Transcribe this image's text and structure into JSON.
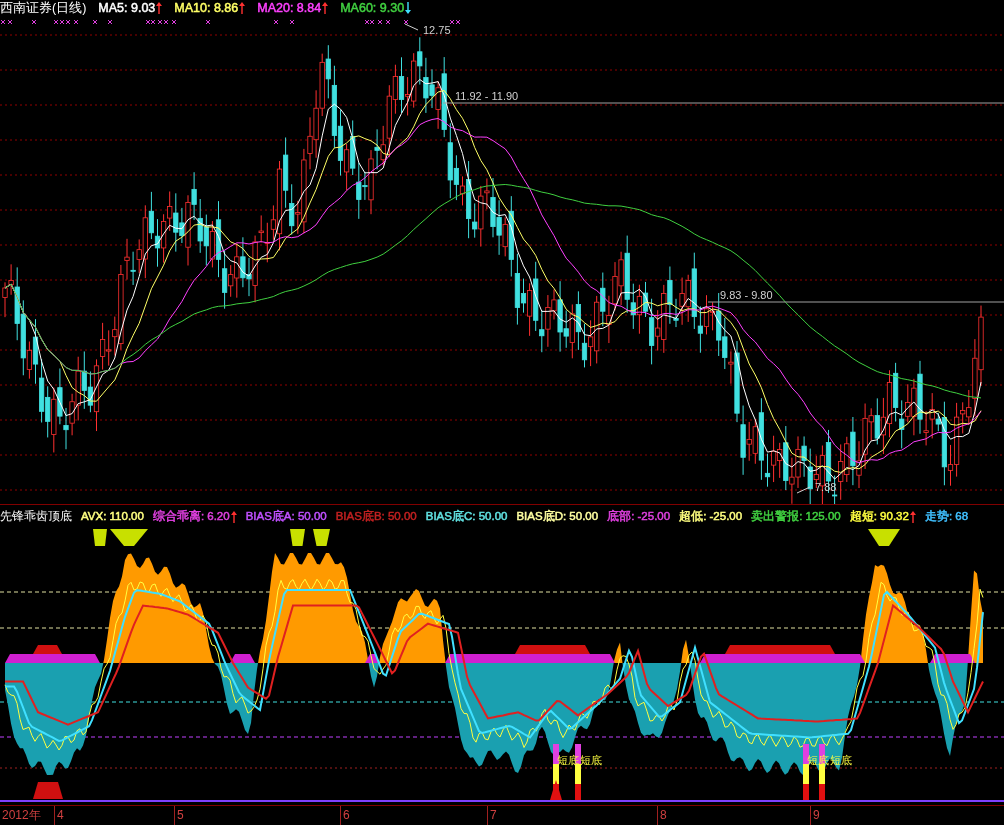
{
  "price_panel": {
    "title": "西南证券(日线)",
    "indicators": [
      {
        "text": "MA5: 9.03",
        "color": "#ffffff",
        "rising": true
      },
      {
        "text": "MA10: 8.86",
        "color": "#ffff66",
        "rising": true
      },
      {
        "text": "MA20: 8.84",
        "color": "#ff40ff",
        "rising": true
      },
      {
        "text": "MA60: 9.30",
        "color": "#40d040",
        "rising": false
      }
    ],
    "price_annotations": [
      {
        "kind": "peak",
        "text": "12.75"
      },
      {
        "kind": "level",
        "text": "11.92 - 11.90"
      },
      {
        "kind": "level",
        "text": "9.83 - 9.80"
      },
      {
        "kind": "trough",
        "text": "7.88"
      }
    ]
  },
  "indicator_panel": {
    "title": "先锋乖齿顶底",
    "indicators": [
      {
        "text": "AVX: 110.00",
        "color": "#ffff80"
      },
      {
        "text": "综合乖离: 6.20",
        "color": "#e040e0",
        "rising": true
      },
      {
        "text": "BIAS底A: 50.00",
        "color": "#c050ff"
      },
      {
        "text": "BIAS底B: 50.00",
        "color": "#c02020"
      },
      {
        "text": "BIAS底C: 50.00",
        "color": "#60e0e0"
      },
      {
        "text": "BIAS底D: 50.00",
        "color": "#ffffa0"
      },
      {
        "text": "底部: -25.00",
        "color": "#e040e0"
      },
      {
        "text": "超低: -25.00",
        "color": "#ffff80"
      },
      {
        "text": "卖出警报: 125.00",
        "color": "#40d040"
      },
      {
        "text": "超短: 90.32",
        "color": "#ffff40",
        "rising": true
      },
      {
        "text": "走势: 68",
        "color": "#40c0ff"
      }
    ],
    "signals": [
      {
        "text": "短底"
      },
      {
        "text": "短底"
      },
      {
        "text": "短底"
      },
      {
        "text": "短底"
      }
    ]
  },
  "time_axis": [
    {
      "text": "2012年"
    },
    {
      "text": "4"
    },
    {
      "text": "5"
    },
    {
      "text": "6"
    },
    {
      "text": "7"
    },
    {
      "text": "8"
    },
    {
      "text": "9"
    }
  ]
}
